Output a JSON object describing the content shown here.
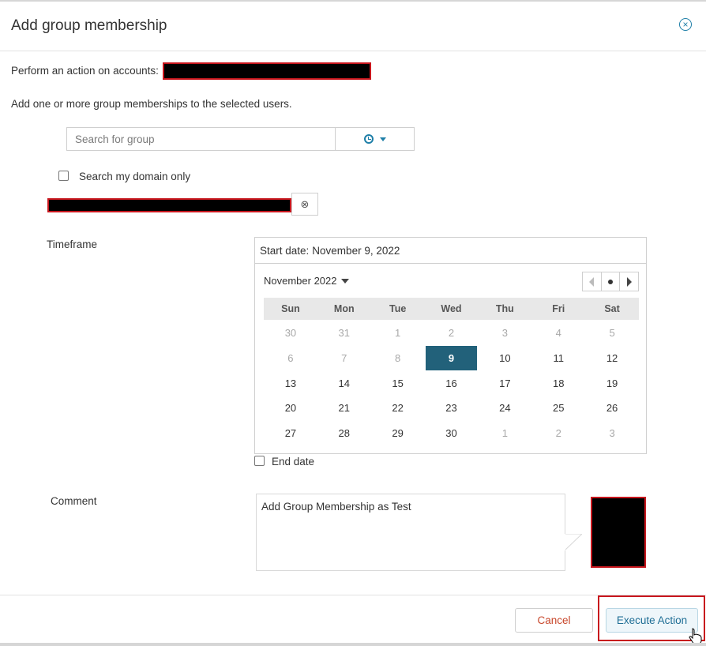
{
  "dialog": {
    "title": "Add group membership",
    "close_icon": "close-circle-icon"
  },
  "accounts": {
    "prefix": "Perform an action on accounts:",
    "redacted": true
  },
  "instruction": "Add one or more group memberships to the selected users.",
  "search": {
    "placeholder": "Search for group",
    "scope_icon": "clock-icon",
    "dropdown_icon": "caret-down-icon",
    "domain_only_label": "Search my domain only",
    "domain_only_checked": false
  },
  "selected_group": {
    "redacted": true,
    "remove_icon": "remove-circle-icon"
  },
  "timeframe": {
    "label": "Timeframe",
    "start_prefix": "Start date:",
    "start_value": "November 9, 2022",
    "calendar": {
      "month_label": "November 2022",
      "weekdays": [
        "Sun",
        "Mon",
        "Tue",
        "Wed",
        "Thu",
        "Fri",
        "Sat"
      ],
      "weeks": [
        [
          {
            "d": "30",
            "m": true
          },
          {
            "d": "31",
            "m": true
          },
          {
            "d": "1",
            "m": true
          },
          {
            "d": "2",
            "m": true
          },
          {
            "d": "3",
            "m": true
          },
          {
            "d": "4",
            "m": true
          },
          {
            "d": "5",
            "m": true
          }
        ],
        [
          {
            "d": "6",
            "m": true
          },
          {
            "d": "7",
            "m": true
          },
          {
            "d": "8",
            "m": true
          },
          {
            "d": "9",
            "sel": true
          },
          {
            "d": "10"
          },
          {
            "d": "11"
          },
          {
            "d": "12"
          }
        ],
        [
          {
            "d": "13"
          },
          {
            "d": "14"
          },
          {
            "d": "15"
          },
          {
            "d": "16"
          },
          {
            "d": "17"
          },
          {
            "d": "18"
          },
          {
            "d": "19"
          }
        ],
        [
          {
            "d": "20"
          },
          {
            "d": "21"
          },
          {
            "d": "22"
          },
          {
            "d": "23"
          },
          {
            "d": "24"
          },
          {
            "d": "25"
          },
          {
            "d": "26"
          }
        ],
        [
          {
            "d": "27"
          },
          {
            "d": "28"
          },
          {
            "d": "29"
          },
          {
            "d": "30"
          },
          {
            "d": "1",
            "m": true
          },
          {
            "d": "2",
            "m": true
          },
          {
            "d": "3",
            "m": true
          }
        ]
      ]
    },
    "end_date_label": "End date",
    "end_date_checked": false
  },
  "comment": {
    "label": "Comment",
    "value": "Add Group Membership as Test"
  },
  "footer": {
    "cancel_label": "Cancel",
    "execute_label": "Execute Action"
  },
  "colors": {
    "accent": "#1f7fa8",
    "selected_day": "#22617a",
    "cancel_text": "#c8472b",
    "redaction_border": "#c8161d"
  }
}
